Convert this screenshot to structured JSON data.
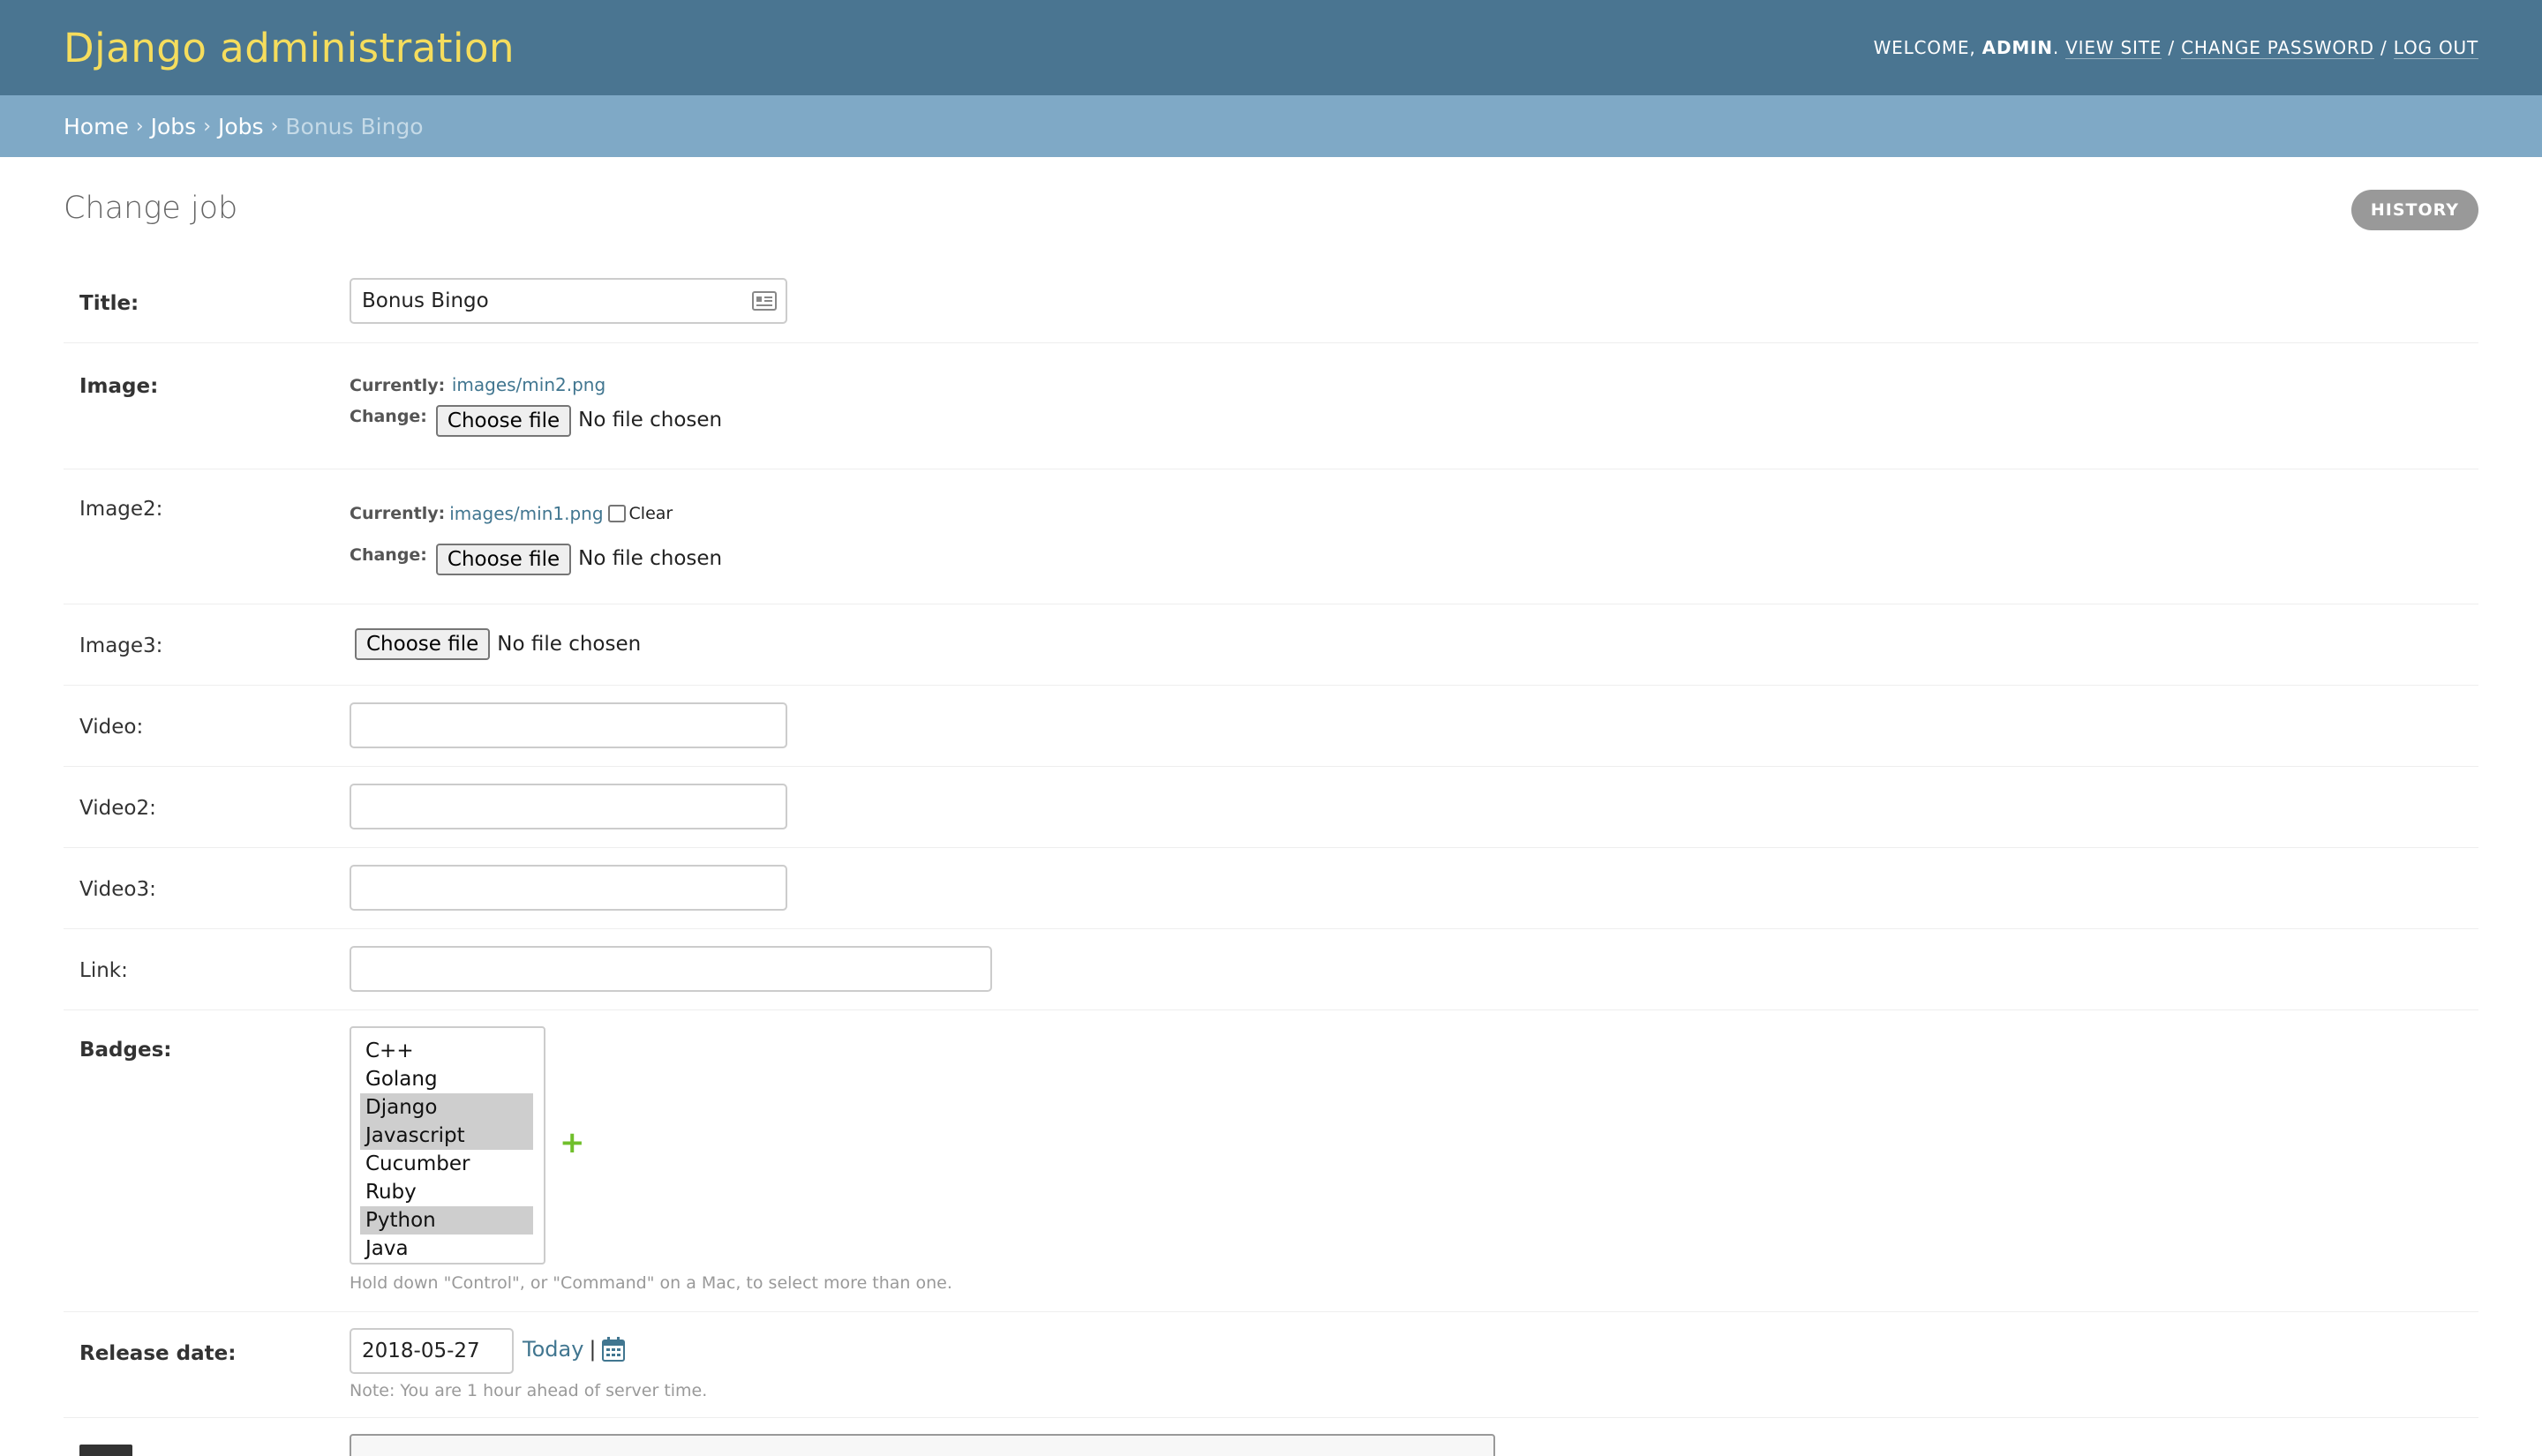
{
  "header": {
    "branding": "Django administration",
    "welcome": "Welcome,",
    "username": "admin",
    "view_site": "View site",
    "change_password": "Change password",
    "log_out": "Log out",
    "sep": "/"
  },
  "breadcrumbs": {
    "home": "Home",
    "app": "Jobs",
    "model": "Jobs",
    "current": "Bonus Bingo",
    "sep": "›"
  },
  "page": {
    "title": "Change job",
    "history_label": "History"
  },
  "form": {
    "title": {
      "label": "Title:",
      "value": "Bonus Bingo"
    },
    "image": {
      "label": "Image:",
      "currently_label": "Currently:",
      "currently_value": "images/min2.png",
      "change_label": "Change:",
      "choose_label": "Choose file",
      "no_file": "No file chosen"
    },
    "image2": {
      "label": "Image2:",
      "currently_label": "Currently:",
      "currently_value": "images/min1.png",
      "clear_label": "Clear",
      "change_label": "Change:",
      "choose_label": "Choose file",
      "no_file": "No file chosen"
    },
    "image3": {
      "label": "Image3:",
      "choose_label": "Choose file",
      "no_file": "No file chosen"
    },
    "video": {
      "label": "Video:",
      "value": ""
    },
    "video2": {
      "label": "Video2:",
      "value": ""
    },
    "video3": {
      "label": "Video3:",
      "value": ""
    },
    "link": {
      "label": "Link:",
      "value": ""
    },
    "badges": {
      "label": "Badges:",
      "options": [
        {
          "label": "C++",
          "selected": false
        },
        {
          "label": "Golang",
          "selected": false
        },
        {
          "label": "Django",
          "selected": true
        },
        {
          "label": "Javascript",
          "selected": true
        },
        {
          "label": "Cucumber",
          "selected": false
        },
        {
          "label": "Ruby",
          "selected": false
        },
        {
          "label": "Python",
          "selected": true
        },
        {
          "label": "Java",
          "selected": false
        }
      ],
      "add_label": "+",
      "help": "Hold down \"Control\", or \"Command\" on a Mac, to select more than one."
    },
    "release_date": {
      "label": "Release date:",
      "value": "2018-05-27",
      "today_label": "Today",
      "sep": "|",
      "help": "Note: You are 1 hour ahead of server time."
    }
  },
  "colors": {
    "header_bg": "#4a7591",
    "branding": "#f5dd5d",
    "breadcrumbs_bg": "#7fa9c6",
    "link": "#417690",
    "add_green": "#70bf2b"
  }
}
